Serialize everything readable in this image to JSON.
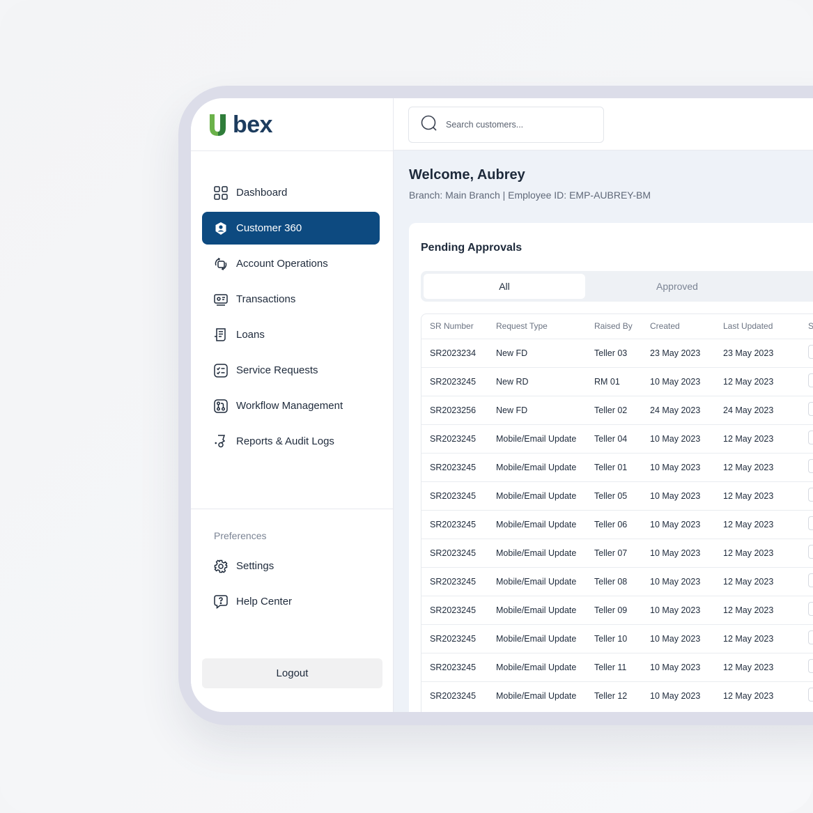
{
  "brand": {
    "logo_text": "bex",
    "accent": "#0d4a80",
    "logo_green": "#6bb24a",
    "logo_navy": "#1d3c5e"
  },
  "sidebar": {
    "items": [
      {
        "label": "Dashboard",
        "icon": "dashboard-grid-icon",
        "active": false
      },
      {
        "label": "Customer 360",
        "icon": "customer-badge-icon",
        "active": true
      },
      {
        "label": "Account Operations",
        "icon": "account-operations-icon",
        "active": false
      },
      {
        "label": "Transactions",
        "icon": "transactions-icon",
        "active": false
      },
      {
        "label": "Loans",
        "icon": "loans-receipt-icon",
        "active": false
      },
      {
        "label": "Service Requests",
        "icon": "checklist-icon",
        "active": false
      },
      {
        "label": "Workflow Management",
        "icon": "workflow-icon",
        "active": false
      },
      {
        "label": "Reports & Audit Logs",
        "icon": "reports-icon",
        "active": false
      }
    ],
    "preferences_label": "Preferences",
    "preferences": [
      {
        "label": "Settings",
        "icon": "gear-icon"
      },
      {
        "label": "Help Center",
        "icon": "help-chat-icon"
      }
    ],
    "logout_label": "Logout"
  },
  "search": {
    "placeholder": "Search customers..."
  },
  "header": {
    "welcome": "Welcome, Aubrey",
    "branch_line": "Branch: Main Branch | Employee ID: EMP-AUBREY-BM"
  },
  "pending": {
    "title": "Pending Approvals",
    "tabs": [
      {
        "label": "All",
        "selected": true
      },
      {
        "label": "Approved",
        "selected": false
      }
    ],
    "columns": [
      "SR Number",
      "Request Type",
      "Raised By",
      "Created",
      "Last Updated",
      "S"
    ],
    "rows": [
      [
        "SR2023234",
        "New FD",
        "Teller 03",
        "23 May 2023",
        "23 May 2023"
      ],
      [
        "SR2023245",
        "New RD",
        "RM 01",
        "10 May 2023",
        "12 May 2023"
      ],
      [
        "SR2023256",
        "New FD",
        "Teller 02",
        "24 May 2023",
        "24 May 2023"
      ],
      [
        "SR2023245",
        "Mobile/Email Update",
        "Teller 04",
        "10 May 2023",
        "12 May 2023"
      ],
      [
        "SR2023245",
        "Mobile/Email Update",
        "Teller 01",
        "10 May 2023",
        "12 May 2023"
      ],
      [
        "SR2023245",
        "Mobile/Email Update",
        "Teller 05",
        "10 May 2023",
        "12 May 2023"
      ],
      [
        "SR2023245",
        "Mobile/Email Update",
        "Teller 06",
        "10 May 2023",
        "12 May 2023"
      ],
      [
        "SR2023245",
        "Mobile/Email Update",
        "Teller 07",
        "10 May 2023",
        "12 May 2023"
      ],
      [
        "SR2023245",
        "Mobile/Email Update",
        "Teller 08",
        "10 May 2023",
        "12 May 2023"
      ],
      [
        "SR2023245",
        "Mobile/Email Update",
        "Teller 09",
        "10 May 2023",
        "12 May 2023"
      ],
      [
        "SR2023245",
        "Mobile/Email Update",
        "Teller 10",
        "10 May 2023",
        "12 May 2023"
      ],
      [
        "SR2023245",
        "Mobile/Email Update",
        "Teller 11",
        "10 May 2023",
        "12 May 2023"
      ],
      [
        "SR2023245",
        "Mobile/Email Update",
        "Teller 12",
        "10 May 2023",
        "12 May 2023"
      ]
    ]
  }
}
